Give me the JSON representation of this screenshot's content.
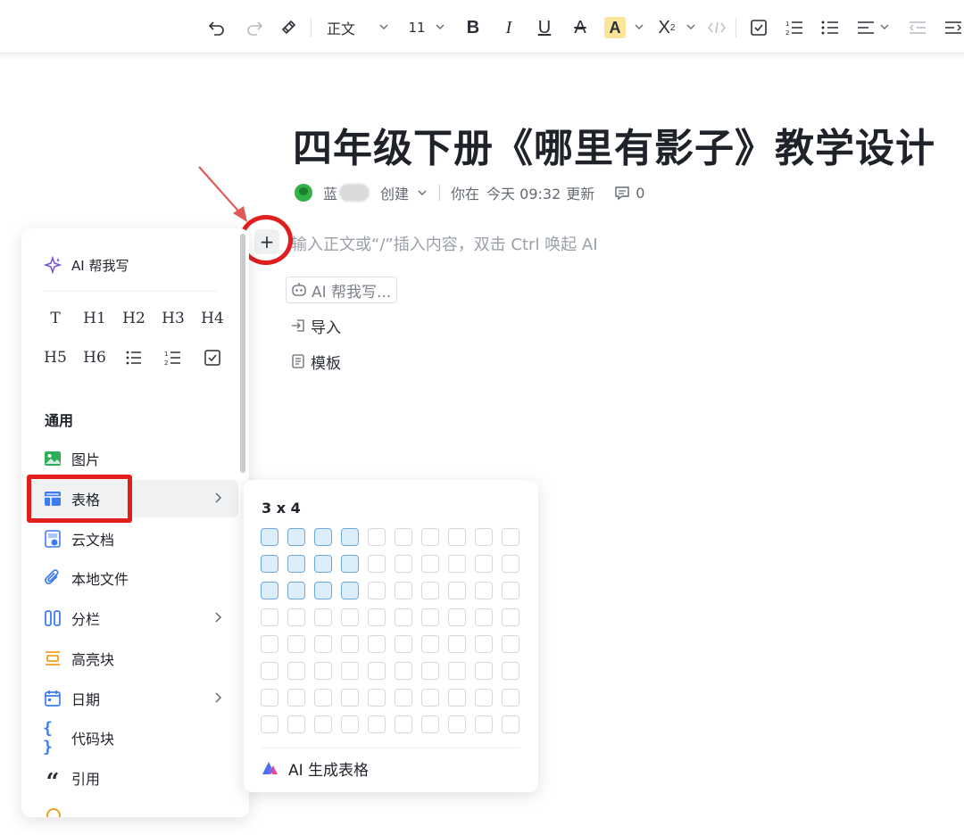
{
  "toolbar": {
    "style_label": "正文",
    "font_size": "11",
    "colors": {
      "highlight": "#fbe59a",
      "border": "#e8e9eb"
    }
  },
  "document": {
    "title": "四年级下册《哪里有影子》教学设计",
    "author_prefix": "蓝",
    "created_label": "创建",
    "updated_by": "你在",
    "updated_time": "今天 09:32",
    "updated_suffix": "更新",
    "comment_count": "0",
    "placeholder": "输入正文或“/”插入内容，双击 Ctrl 唤起 AI"
  },
  "quick_options": {
    "ai_write": "AI 帮我写...",
    "import": "导入",
    "template": "模板"
  },
  "insert_menu": {
    "ai_write": "AI 帮我写",
    "headings_row1": [
      "T",
      "H1",
      "H2",
      "H3",
      "H4"
    ],
    "headings_row2": [
      "H5",
      "H6"
    ],
    "section_general": "通用",
    "items": [
      {
        "label": "图片",
        "icon": "image-icon",
        "submenu": false
      },
      {
        "label": "表格",
        "icon": "table-icon",
        "submenu": true
      },
      {
        "label": "云文档",
        "icon": "cloud-doc-icon",
        "submenu": false
      },
      {
        "label": "本地文件",
        "icon": "paperclip-icon",
        "submenu": false
      },
      {
        "label": "分栏",
        "icon": "columns-icon",
        "submenu": true
      },
      {
        "label": "高亮块",
        "icon": "highlight-block-icon",
        "submenu": false
      },
      {
        "label": "日期",
        "icon": "calendar-icon",
        "submenu": true
      },
      {
        "label": "代码块",
        "icon": "braces-icon",
        "submenu": false
      },
      {
        "label": "引用",
        "icon": "quote-icon",
        "submenu": false
      }
    ]
  },
  "table_picker": {
    "size_label": "3 x 4",
    "rows": 8,
    "cols": 10,
    "selected_rows": 3,
    "selected_cols": 4,
    "ai_generate": "AI 生成表格",
    "colors": {
      "selected_fill": "#dceefa",
      "selected_border": "#6fa8dc"
    }
  },
  "annotations": {
    "color": "#e01e1e"
  }
}
